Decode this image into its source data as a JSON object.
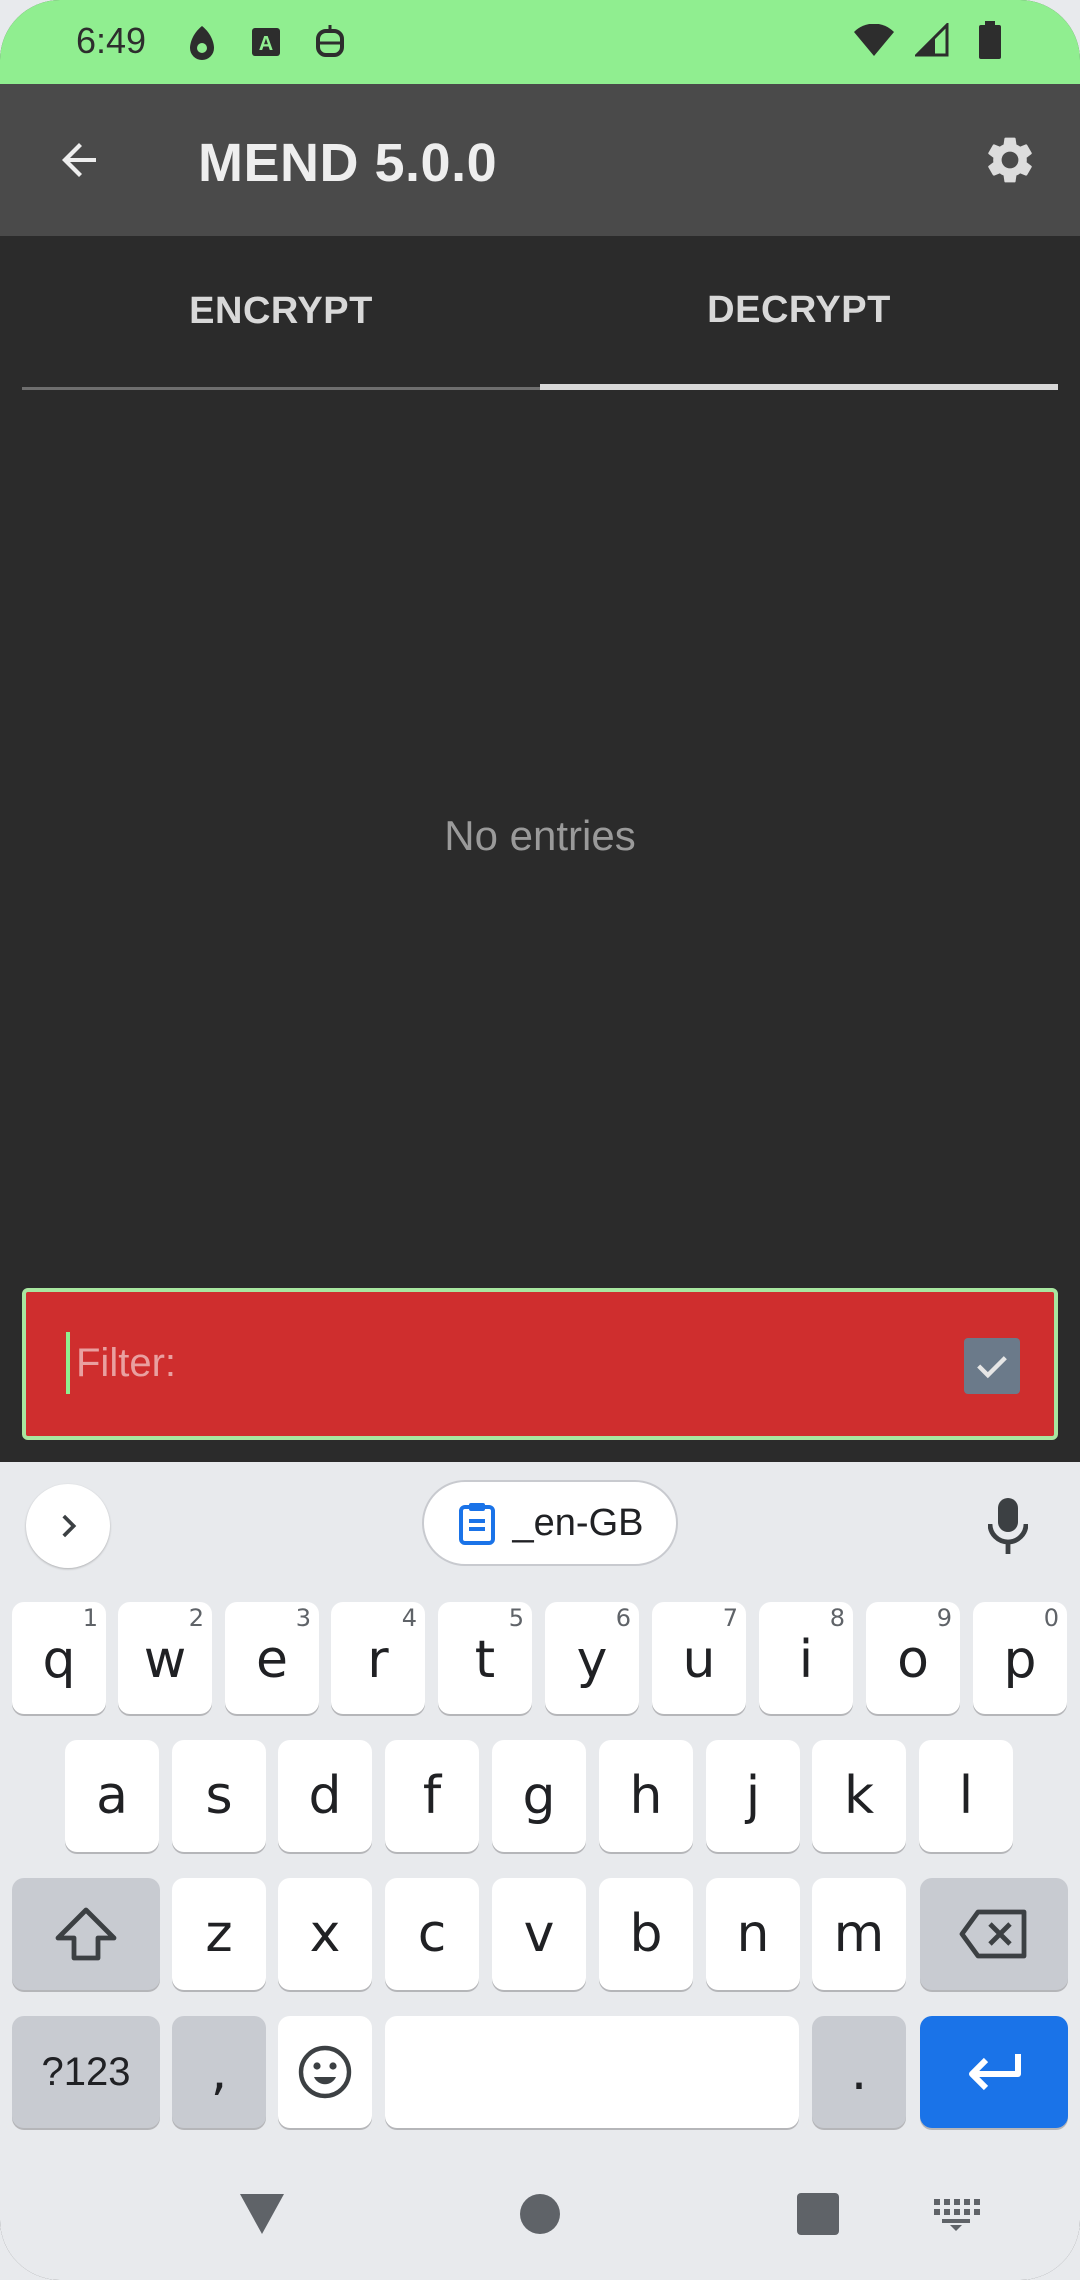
{
  "status_bar": {
    "time": "6:49",
    "left_icons": [
      "notification-dot-icon",
      "text-a-icon",
      "robot-face-icon"
    ],
    "right_icons": [
      "wifi-icon",
      "cell-signal-icon",
      "battery-icon"
    ],
    "background": "#90ee90"
  },
  "app_bar": {
    "title": "MEND 5.0.0",
    "back_icon": "arrow-back-icon",
    "settings_icon": "gear-icon"
  },
  "tabs": [
    {
      "label": "ENCRYPT",
      "selected": false
    },
    {
      "label": "DECRYPT",
      "selected": true
    }
  ],
  "content": {
    "empty_message": "No entries"
  },
  "filter": {
    "placeholder": "Filter:",
    "value": "",
    "checkbox_checked": true,
    "background": "#cf2e2e"
  },
  "keyboard": {
    "chip_label": "_en-GB",
    "row1": [
      {
        "k": "q",
        "h": "1"
      },
      {
        "k": "w",
        "h": "2"
      },
      {
        "k": "e",
        "h": "3"
      },
      {
        "k": "r",
        "h": "4"
      },
      {
        "k": "t",
        "h": "5"
      },
      {
        "k": "y",
        "h": "6"
      },
      {
        "k": "u",
        "h": "7"
      },
      {
        "k": "i",
        "h": "8"
      },
      {
        "k": "o",
        "h": "9"
      },
      {
        "k": "p",
        "h": "0"
      }
    ],
    "row2": [
      "a",
      "s",
      "d",
      "f",
      "g",
      "h",
      "j",
      "k",
      "l"
    ],
    "row3": [
      "z",
      "x",
      "c",
      "v",
      "b",
      "n",
      "m"
    ],
    "symbols_label": "?123",
    "comma_label": ",",
    "period_label": ".",
    "enter_color": "#1a73e8"
  },
  "nav_bar": {
    "icons": [
      "back-triangle-icon",
      "home-circle-icon",
      "recents-square-icon",
      "keyboard-switch-icon"
    ]
  }
}
